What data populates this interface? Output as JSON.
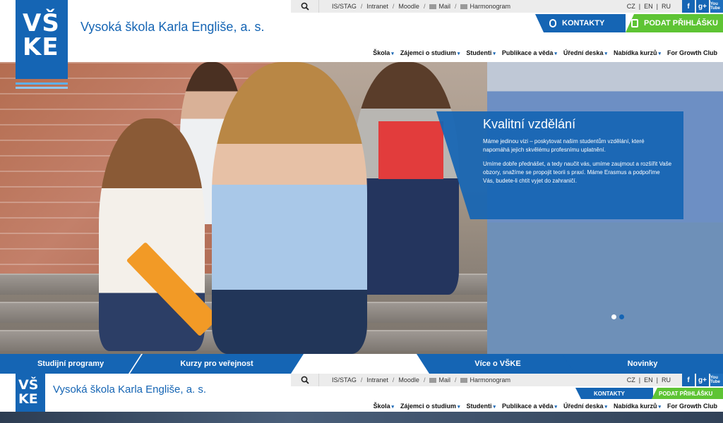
{
  "header": {
    "logo_lines": [
      "VŠ",
      "KE"
    ],
    "school_name": "Vysoká škola Karla Engliše, a. s.",
    "util_links": [
      "IS/STAG",
      "Intranet",
      "Moodle",
      "Mail",
      "Harmonogram"
    ],
    "langs": [
      "CZ",
      "EN",
      "RU"
    ],
    "social": [
      {
        "icon": "facebook-icon",
        "label": "f"
      },
      {
        "icon": "googleplus-icon",
        "label": "g+"
      },
      {
        "icon": "youtube-icon",
        "label": "You Tube"
      }
    ],
    "kontakty": "KONTAKTY",
    "podat": "PODAT PŘIHLÁŠKU"
  },
  "nav": [
    "Škola",
    "Zájemci o studium",
    "Studenti",
    "Publikace a věda",
    "Úřední deska",
    "Nabídka kurzů",
    "For Growth Club"
  ],
  "hero": {
    "title": "Kvalitní vzdělání",
    "p1": "Máme jedinou vizi – poskytovat našim studentům vzdělání, které napomáhá jejich skvělému profesnímu uplatnění.",
    "p2": "Umíme dobře přednášet, a tedy naučit vás, umíme zaujmout a rozšířit Vaše obzory, snažíme se propojit teorii s praxí. Máme Erasmus a podpoříme Vás, budete-li chtít vyjet do zahraničí."
  },
  "quicklinks": [
    "Studijní programy",
    "Kurzy pro veřejnost",
    "Více o VŠKE",
    "Novinky"
  ],
  "colors": {
    "brand_blue": "#1565b4",
    "green": "#5ec434"
  }
}
